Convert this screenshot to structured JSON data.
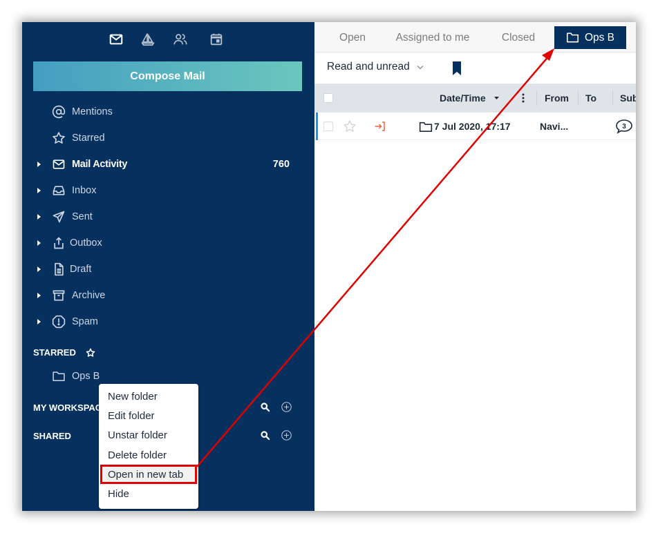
{
  "sidebar": {
    "top_icons": [
      {
        "name": "mail-icon",
        "active": true
      },
      {
        "name": "sailboat-icon",
        "active": false
      },
      {
        "name": "users-icon",
        "active": false
      },
      {
        "name": "calendar-icon",
        "active": false
      }
    ],
    "compose_label": "Compose Mail",
    "nav": [
      {
        "label": "Mentions",
        "icon": "at-icon",
        "caret": false
      },
      {
        "label": "Starred",
        "icon": "star-icon",
        "caret": false
      },
      {
        "label": "Mail Activity",
        "icon": "envelope-icon",
        "caret": true,
        "bold": true,
        "count": "760"
      },
      {
        "label": "Inbox",
        "icon": "inbox-icon",
        "caret": true
      },
      {
        "label": "Sent",
        "icon": "send-icon",
        "caret": true
      },
      {
        "label": "Outbox",
        "icon": "upload-icon",
        "caret": true
      },
      {
        "label": "Draft",
        "icon": "document-icon",
        "caret": true
      },
      {
        "label": "Archive",
        "icon": "archive-icon",
        "caret": true
      },
      {
        "label": "Spam",
        "icon": "alert-octagon-icon",
        "caret": true
      }
    ],
    "starred_section": {
      "title": "STARRED",
      "folders": [
        {
          "label": "Ops B"
        }
      ]
    },
    "workspace_section": {
      "title": "MY WORKSPACE"
    },
    "shared_section": {
      "title": "SHARED"
    }
  },
  "context_menu": {
    "items": [
      {
        "label": "New folder"
      },
      {
        "label": "Edit folder"
      },
      {
        "label": "Unstar folder"
      },
      {
        "label": "Delete folder"
      },
      {
        "label": "Open in new tab",
        "highlighted": true
      },
      {
        "label": "Hide"
      }
    ]
  },
  "main": {
    "tabs": [
      {
        "label": "Open"
      },
      {
        "label": "Assigned to me"
      },
      {
        "label": "Closed"
      },
      {
        "label": "Ops B",
        "active": true
      }
    ],
    "filter": {
      "selected": "Read and unread"
    },
    "table": {
      "columns": [
        "Date/Time",
        "From",
        "To",
        "Sub"
      ],
      "rows": [
        {
          "datetime": "7 Jul 2020, 17:17",
          "from": "Navi...",
          "to": "",
          "comment_count": "3"
        }
      ]
    }
  },
  "annotation": {
    "color": "#e00000"
  }
}
